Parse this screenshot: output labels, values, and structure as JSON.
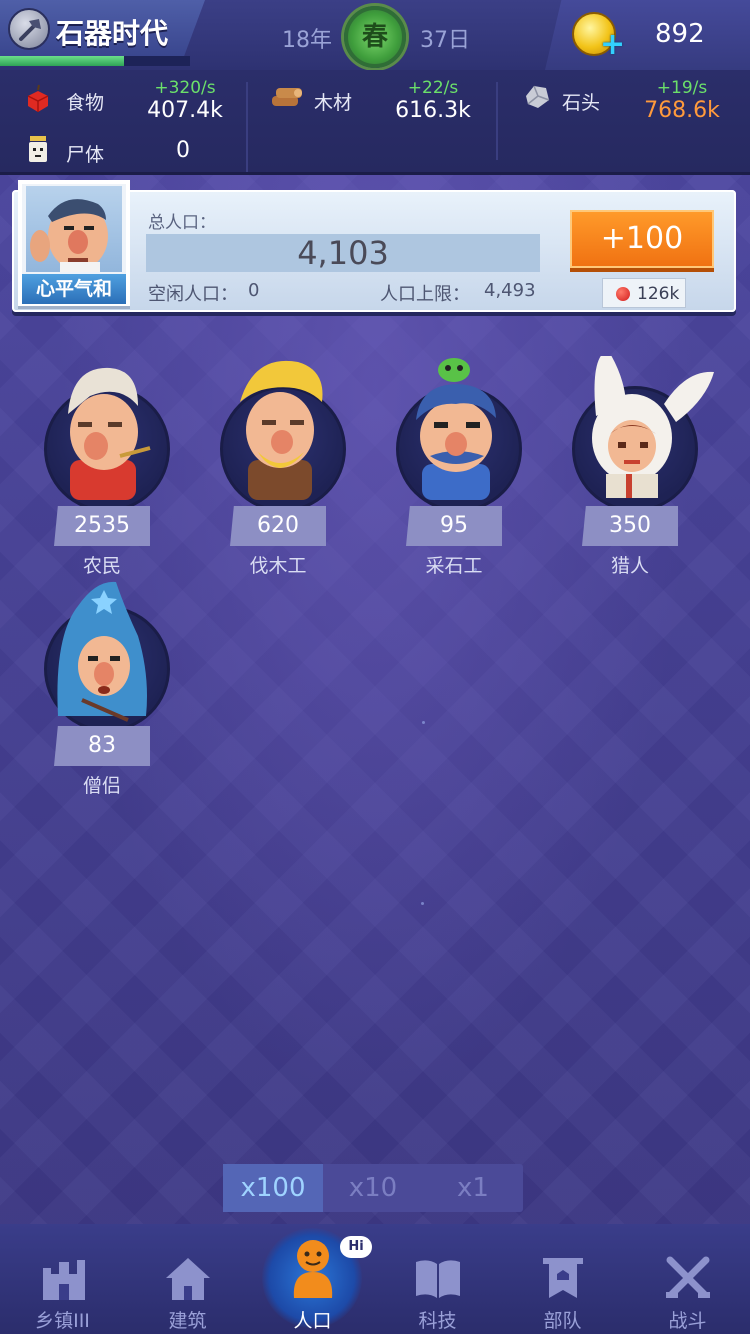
{
  "header": {
    "era_title": "石器时代",
    "era_icon": "stone-axe-icon",
    "era_progress": 0.65,
    "year": "18年",
    "season": "春",
    "day": "37日",
    "currency_icon": "gold-coin-icon",
    "currency_value": "892"
  },
  "resources": {
    "food": {
      "name": "食物",
      "rate": "+320/s",
      "value": "407.4k",
      "icon": "apple-icon"
    },
    "wood": {
      "name": "木材",
      "rate": "+22/s",
      "value": "616.3k",
      "icon": "wood-log-icon"
    },
    "stone": {
      "name": "石头",
      "rate": "+19/s",
      "value": "768.6k",
      "icon": "stone-icon"
    },
    "corpse": {
      "name": "尸体",
      "value": "0",
      "icon": "corpse-icon"
    }
  },
  "population": {
    "advisor_mood": "心平气和",
    "total_label": "总人口：",
    "total": "4,103",
    "idle_label": "空闲人口：",
    "idle": "0",
    "cap_label": "人口上限：",
    "cap": "4,493",
    "add_label": "+100",
    "cost": "126k"
  },
  "workers": [
    {
      "name": "农民",
      "count": "2535"
    },
    {
      "name": "伐木工",
      "count": "620"
    },
    {
      "name": "采石工",
      "count": "95"
    },
    {
      "name": "猎人",
      "count": "350"
    },
    {
      "name": "僧侣",
      "count": "83"
    }
  ],
  "multiplier": {
    "options": [
      "x100",
      "x10",
      "x1"
    ],
    "selected": "x100"
  },
  "nav": {
    "items": [
      {
        "label": "乡镇III",
        "icon": "castle-icon"
      },
      {
        "label": "建筑",
        "icon": "house-icon"
      },
      {
        "label": "人口",
        "icon": "person-icon"
      },
      {
        "label": "科技",
        "icon": "book-icon"
      },
      {
        "label": "部队",
        "icon": "banner-icon"
      },
      {
        "label": "战斗",
        "icon": "crossed-swords-icon"
      }
    ],
    "active": "人口",
    "badge": "Hi"
  },
  "colors": {
    "background": "#3f3a8a",
    "rate_green": "#6be06a",
    "warning_orange": "#ff9a3c",
    "add_button": "#f58a1e",
    "count_badge": "#8d8fc4"
  }
}
